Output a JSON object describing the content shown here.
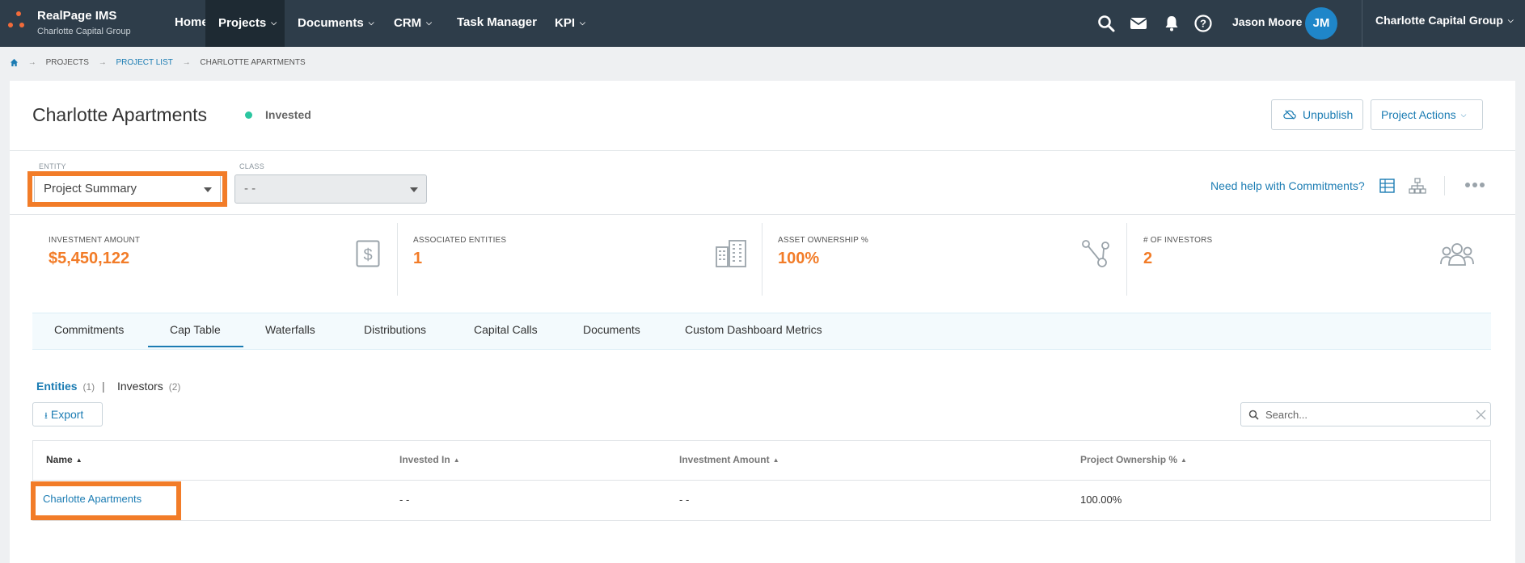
{
  "app": {
    "name": "RealPage IMS",
    "org_sub": "Charlotte Capital Group",
    "colors": {
      "nav_bg": "#2e3d4a",
      "accent": "#1b7cb3",
      "orange": "#f27c28",
      "status_green": "#2bc6a0"
    }
  },
  "nav": {
    "items": [
      {
        "label": "Home",
        "dropdown": false
      },
      {
        "label": "Projects",
        "dropdown": true,
        "active": true
      },
      {
        "label": "Documents",
        "dropdown": true
      },
      {
        "label": "CRM",
        "dropdown": true
      },
      {
        "label": "Task Manager",
        "dropdown": false
      },
      {
        "label": "KPI",
        "dropdown": true
      }
    ],
    "icons": [
      "search-icon",
      "mail-icon",
      "bell-icon",
      "help-icon"
    ],
    "user_name": "Jason Moore",
    "user_initials": "JM",
    "org_switch": "Charlotte Capital Group"
  },
  "breadcrumb": {
    "home_icon": "home-icon",
    "items": [
      "PROJECTS",
      "PROJECT LIST",
      "CHARLOTTE APARTMENTS"
    ]
  },
  "project": {
    "title": "Charlotte Apartments",
    "status": "Invested",
    "unpublish_label": "Unpublish",
    "actions_label": "Project Actions"
  },
  "filters": {
    "entity_label": "ENTITY",
    "entity_value": "Project Summary",
    "class_label": "CLASS",
    "class_value": "- -",
    "help_link": "Need help with Commitments?"
  },
  "stats": [
    {
      "label": "INVESTMENT AMOUNT",
      "value": "$5,450,122",
      "icon": "dollar-document-icon"
    },
    {
      "label": "ASSOCIATED ENTITIES",
      "value": "1",
      "icon": "buildings-icon"
    },
    {
      "label": "ASSET OWNERSHIP %",
      "value": "100%",
      "icon": "ownership-nodes-icon"
    },
    {
      "label": "# OF INVESTORS",
      "value": "2",
      "icon": "investors-group-icon"
    }
  ],
  "tabs": [
    "Commitments",
    "Cap Table",
    "Waterfalls",
    "Distributions",
    "Capital Calls",
    "Documents",
    "Custom Dashboard Metrics"
  ],
  "active_tab": "Cap Table",
  "subtabs": {
    "entities_label": "Entities",
    "entities_count": "(1)",
    "separator": "|",
    "investors_label": "Investors",
    "investors_count": "(2)"
  },
  "export_label": "Export",
  "search_placeholder": "Search...",
  "table": {
    "columns": [
      "Name",
      "Invested In",
      "Investment Amount",
      "Project Ownership %"
    ],
    "rows": [
      {
        "name": "Charlotte Apartments",
        "invested_in": "- -",
        "investment_amount": "- -",
        "ownership": "100.00%"
      }
    ]
  }
}
